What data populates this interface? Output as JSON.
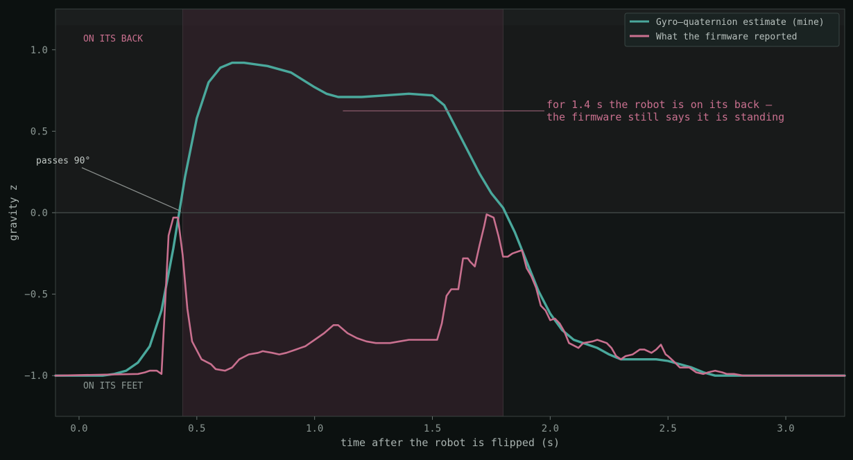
{
  "chart_data": {
    "type": "line",
    "xlabel": "time after the robot is flipped  (s)",
    "ylabel": "gravity z",
    "xlim": [
      -0.1,
      3.25
    ],
    "ylim": [
      -1.25,
      1.25
    ],
    "x_ticks": [
      0.0,
      0.5,
      1.0,
      1.5,
      2.0,
      2.5,
      3.0
    ],
    "x_tick_labels": [
      "0.0",
      "0.5",
      "1.0",
      "1.5",
      "2.0",
      "2.5",
      "3.0"
    ],
    "y_ticks": [
      1.0,
      0.5,
      0.0,
      -0.5,
      -1.0
    ],
    "y_tick_labels": [
      "1.0",
      "0.5",
      "0.0",
      "−0.5",
      "−1.0"
    ],
    "grid": false,
    "legend_position": "top-right",
    "shaded_interval": [
      0.44,
      1.8
    ],
    "zones": {
      "back_label": "ON ITS BACK",
      "feet_label": "ON ITS FEET"
    },
    "annotations": {
      "crossing": {
        "text": "passes 90°",
        "x": 0.43,
        "y": 0.0
      },
      "note": {
        "lines": [
          "for 1.4 s the robot is on its back —",
          "the firmware still says it is standing"
        ],
        "x": 1.12,
        "y": 0.62
      }
    },
    "series": [
      {
        "name": "Gyro–quaternion estimate (mine)",
        "color": "#4aa89c",
        "x": [
          -0.1,
          0.1,
          0.15,
          0.2,
          0.25,
          0.3,
          0.35,
          0.4,
          0.45,
          0.5,
          0.55,
          0.6,
          0.65,
          0.7,
          0.8,
          0.9,
          1.0,
          1.05,
          1.1,
          1.2,
          1.3,
          1.4,
          1.5,
          1.55,
          1.6,
          1.65,
          1.7,
          1.75,
          1.8,
          1.85,
          1.9,
          1.95,
          2.0,
          2.05,
          2.1,
          2.2,
          2.25,
          2.3,
          2.35,
          2.4,
          2.45,
          2.5,
          2.6,
          2.65,
          2.7,
          3.0,
          3.25
        ],
        "y": [
          -1.0,
          -1.0,
          -0.99,
          -0.97,
          -0.92,
          -0.82,
          -0.6,
          -0.22,
          0.22,
          0.58,
          0.8,
          0.89,
          0.92,
          0.92,
          0.9,
          0.86,
          0.77,
          0.73,
          0.71,
          0.71,
          0.72,
          0.73,
          0.72,
          0.66,
          0.52,
          0.38,
          0.24,
          0.12,
          0.03,
          -0.12,
          -0.3,
          -0.48,
          -0.62,
          -0.72,
          -0.78,
          -0.83,
          -0.87,
          -0.9,
          -0.9,
          -0.9,
          -0.9,
          -0.91,
          -0.95,
          -0.98,
          -1.0,
          -1.0,
          -1.0
        ]
      },
      {
        "name": "What the firmware reported",
        "color": "#c9708f",
        "x": [
          -0.1,
          0.25,
          0.28,
          0.3,
          0.33,
          0.35,
          0.38,
          0.4,
          0.42,
          0.44,
          0.46,
          0.48,
          0.52,
          0.56,
          0.58,
          0.62,
          0.65,
          0.68,
          0.72,
          0.76,
          0.78,
          0.82,
          0.85,
          0.88,
          0.92,
          0.94,
          0.96,
          0.98,
          1.0,
          1.04,
          1.08,
          1.1,
          1.14,
          1.18,
          1.22,
          1.26,
          1.32,
          1.36,
          1.4,
          1.44,
          1.48,
          1.52,
          1.54,
          1.56,
          1.58,
          1.61,
          1.63,
          1.65,
          1.66,
          1.68,
          1.7,
          1.72,
          1.73,
          1.76,
          1.78,
          1.8,
          1.82,
          1.84,
          1.88,
          1.9,
          1.92,
          1.94,
          1.96,
          1.98,
          2.0,
          2.02,
          2.04,
          2.06,
          2.08,
          2.12,
          2.14,
          2.18,
          2.2,
          2.24,
          2.26,
          2.28,
          2.3,
          2.32,
          2.35,
          2.38,
          2.4,
          2.43,
          2.45,
          2.47,
          2.49,
          2.5,
          2.53,
          2.55,
          2.57,
          2.59,
          2.62,
          2.65,
          2.67,
          2.7,
          2.73,
          2.75,
          2.78,
          2.82,
          2.85,
          3.25
        ],
        "y": [
          -1.0,
          -0.99,
          -0.98,
          -0.97,
          -0.97,
          -0.99,
          -0.14,
          -0.03,
          -0.03,
          -0.26,
          -0.59,
          -0.79,
          -0.9,
          -0.93,
          -0.96,
          -0.97,
          -0.95,
          -0.9,
          -0.87,
          -0.86,
          -0.85,
          -0.86,
          -0.87,
          -0.86,
          -0.84,
          -0.83,
          -0.82,
          -0.8,
          -0.78,
          -0.74,
          -0.69,
          -0.69,
          -0.74,
          -0.77,
          -0.79,
          -0.8,
          -0.8,
          -0.79,
          -0.78,
          -0.78,
          -0.78,
          -0.78,
          -0.68,
          -0.51,
          -0.47,
          -0.47,
          -0.28,
          -0.28,
          -0.3,
          -0.33,
          -0.2,
          -0.08,
          -0.01,
          -0.03,
          -0.14,
          -0.27,
          -0.27,
          -0.25,
          -0.23,
          -0.34,
          -0.39,
          -0.46,
          -0.57,
          -0.6,
          -0.66,
          -0.65,
          -0.68,
          -0.73,
          -0.8,
          -0.83,
          -0.8,
          -0.79,
          -0.78,
          -0.8,
          -0.83,
          -0.88,
          -0.9,
          -0.88,
          -0.87,
          -0.84,
          -0.84,
          -0.86,
          -0.84,
          -0.81,
          -0.87,
          -0.88,
          -0.92,
          -0.95,
          -0.95,
          -0.95,
          -0.98,
          -0.99,
          -0.98,
          -0.97,
          -0.98,
          -0.99,
          -0.99,
          -1.0,
          -1.0,
          -1.0
        ]
      }
    ]
  }
}
